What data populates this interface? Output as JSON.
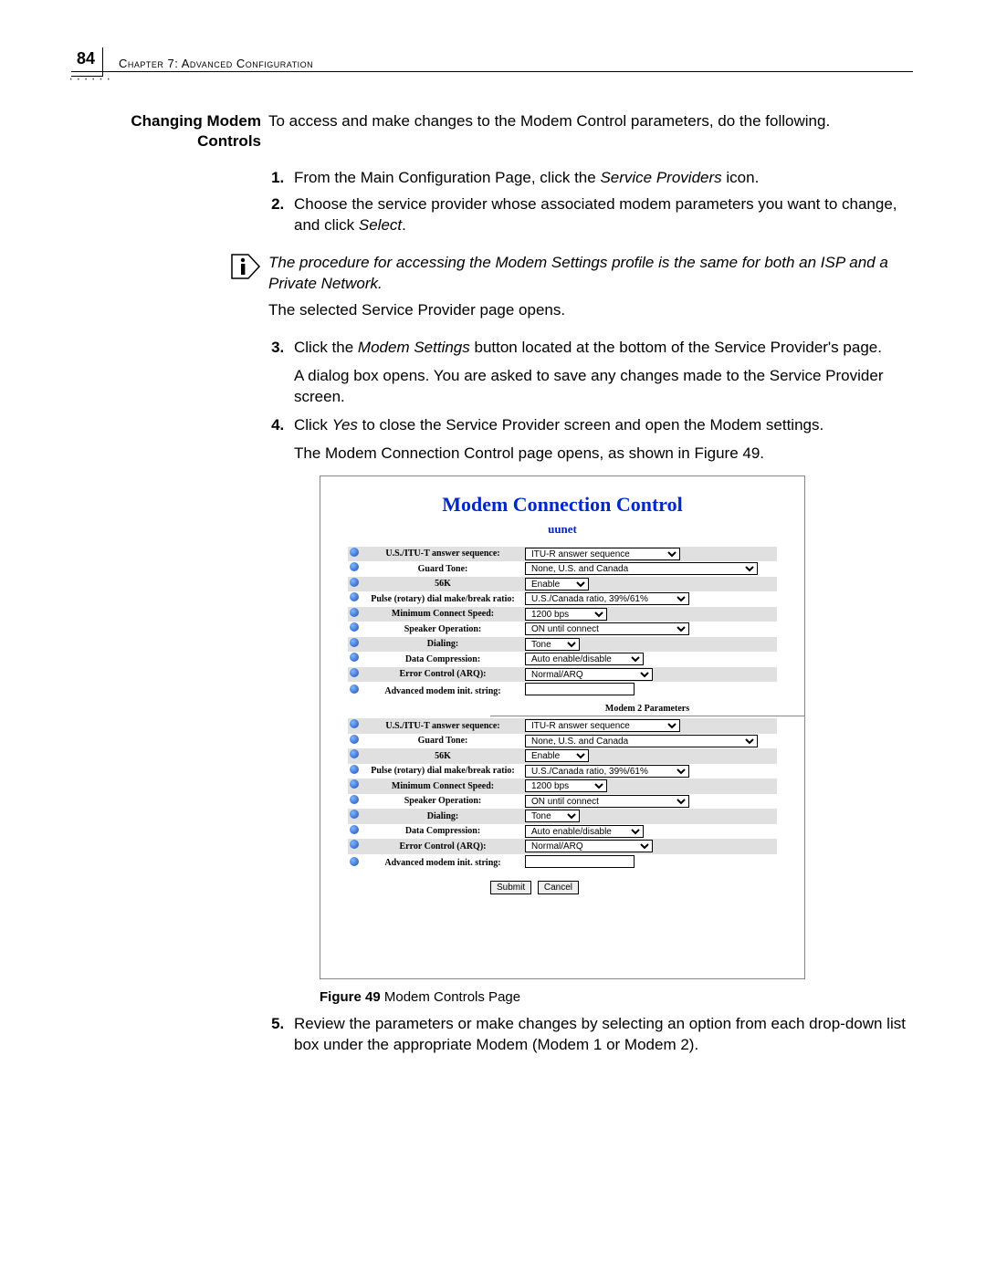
{
  "page_number": "84",
  "running_head": "Chapter 7: Advanced Configuration",
  "dots": "······",
  "section": {
    "side_heading_l1": "Changing Modem",
    "side_heading_l2": "Controls",
    "intro": "To access and make changes to the Modem Control parameters, do the following."
  },
  "steps": {
    "s1_a": "From the Main Configuration Page, click the ",
    "s1_i": "Service Providers",
    "s1_b": " icon.",
    "s2_a": "Choose the service provider whose associated modem parameters you want to change, and click ",
    "s2_i": "Select",
    "s2_b": ".",
    "s3_a": "Click the ",
    "s3_i": "Modem Settings",
    "s3_b": " button located at the bottom of the Service Provider's page.",
    "s3_follow": "A dialog box opens. You are asked to save any changes made to the Service Provider screen.",
    "s4_a": "Click ",
    "s4_i": "Yes",
    "s4_b": " to close the Service Provider screen and open the Modem settings.",
    "s4_follow": "The Modem Connection Control page opens, as shown in Figure 49.",
    "s5": "Review the parameters or make changes by selecting an option from each drop-down list box under the appropriate Modem (Modem 1 or Modem 2)."
  },
  "note": "The procedure for accessing the Modem Settings profile is the same for both an ISP and a Private Network.",
  "note_follow": "The selected Service Provider page opens.",
  "figure": {
    "title": "Modem Connection Control",
    "subtitle": "uunet",
    "section2": "Modem 2 Parameters",
    "labels": {
      "answer_seq": "U.S./ITU-T answer sequence:",
      "guard_tone": "Guard Tone:",
      "k56": "56K",
      "pulse_ratio": "Pulse (rotary) dial make/break ratio:",
      "min_speed": "Minimum Connect Speed:",
      "speaker": "Speaker Operation:",
      "dialing": "Dialing:",
      "data_comp": "Data Compression:",
      "error_ctrl": "Error Control (ARQ):",
      "adv_init": "Advanced modem init. string:"
    },
    "values": {
      "answer_seq": "ITU-R answer sequence",
      "guard_tone": "None, U.S. and Canada",
      "k56": "Enable",
      "pulse_ratio": "U.S./Canada ratio, 39%/61%",
      "min_speed": "1200 bps",
      "speaker": "ON until connect",
      "dialing": "Tone",
      "data_comp": "Auto enable/disable",
      "error_ctrl": "Normal/ARQ"
    },
    "widths": {
      "answer_seq": "170",
      "guard_tone": "255",
      "k56": "70",
      "pulse_ratio": "180",
      "min_speed": "90",
      "speaker": "180",
      "dialing": "60",
      "data_comp": "130",
      "error_ctrl": "140"
    },
    "buttons": {
      "submit": "Submit",
      "cancel": "Cancel"
    }
  },
  "figure_caption_b": "Figure 49",
  "figure_caption_t": "   Modem Controls Page"
}
